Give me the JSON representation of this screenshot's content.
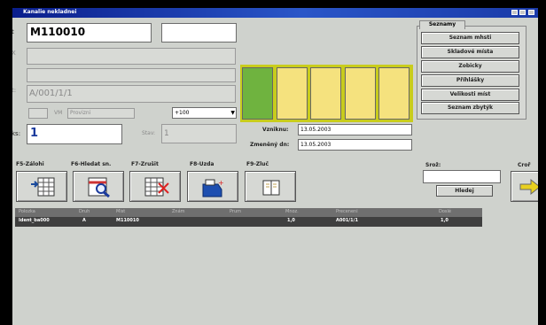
{
  "window": {
    "title": "Kanalie nekladnei"
  },
  "form": {
    "code_value": "M110010",
    "location_value": "A/001/1/1",
    "amount_value": "1",
    "combo_value": "Provizni",
    "state_label": "Stav:",
    "state_value": "1",
    "qty_select_value": "+100",
    "label_edge_a": "t",
    "label_edge_b": "X",
    "label_edge_c": "t:",
    "label_edge_d": "ks:",
    "label_vm": "VM"
  },
  "gauge": {
    "cells": 5,
    "filled": 1,
    "fill_color": "#6fb33f",
    "empty_color": "#f5e27e"
  },
  "dates": {
    "vzniknu_label": "Vzniknu:",
    "vzniknu_value": "13.05.2003",
    "zmena_label": "Zmeněný dn:",
    "zmena_value": "13.05.2003"
  },
  "tab": {
    "title": "Seznamy",
    "items": [
      "Seznam mhsti",
      "Skladové místa",
      "Zobicky",
      "Příhlášky",
      "Velikosti míst",
      "Seznam zbytýk"
    ]
  },
  "toolbar": [
    {
      "label": "F5-Zálohi",
      "icon": "grid-arrow-icon"
    },
    {
      "label": "F6-Hledat sn.",
      "icon": "search-doc-icon"
    },
    {
      "label": "F7-Zrušit",
      "icon": "grid-cross-icon"
    },
    {
      "label": "F8-Uzda",
      "icon": "printer-icon"
    },
    {
      "label": "F9-Zluč",
      "icon": "book-icon"
    }
  ],
  "search": {
    "label": "Srož:",
    "button": "Hledej",
    "value": ""
  },
  "right_edge": {
    "label": "Croř"
  },
  "table": {
    "headers": [
      "Polozka",
      "Druh",
      "Mist",
      "Znám",
      "Prum",
      "Mnoz.",
      "Preceneni",
      "Doslé"
    ],
    "rows": [
      [
        "Ident_ba000",
        "A",
        "M110010",
        "",
        "",
        "1,0",
        "A001/1/1",
        "1,0"
      ]
    ]
  }
}
